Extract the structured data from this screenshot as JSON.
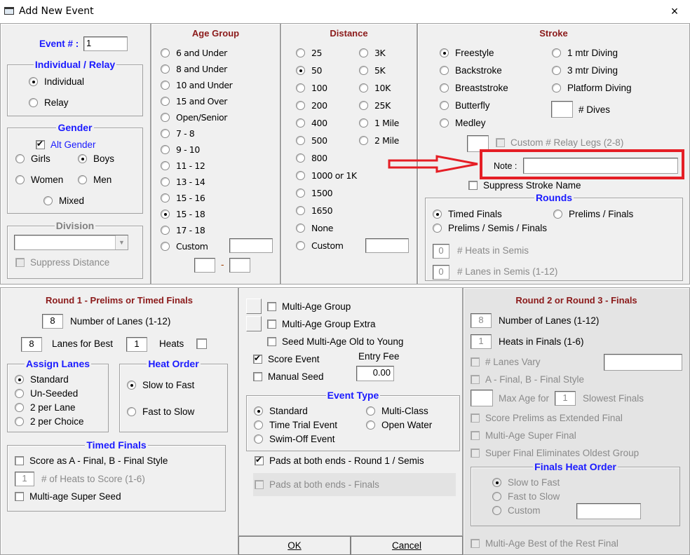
{
  "window": {
    "title": "Add New Event",
    "close_label": "×"
  },
  "event": {
    "number_label": "Event # :",
    "number_value": "1"
  },
  "individual_relay": {
    "title": "Individual / Relay",
    "options": [
      "Individual",
      "Relay"
    ],
    "selected": "Individual"
  },
  "gender": {
    "title": "Gender",
    "alt_gender_label": "Alt Gender",
    "alt_gender_checked": true,
    "options": [
      "Girls",
      "Boys",
      "Women",
      "Men",
      "Mixed"
    ],
    "selected": "Boys"
  },
  "division": {
    "title": "Division",
    "value": "",
    "suppress_distance_label": "Suppress Distance"
  },
  "age_group": {
    "title": "Age Group",
    "options": [
      "6 and Under",
      "8 and Under",
      "10 and Under",
      "15 and Over",
      "Open/Senior",
      "7 - 8",
      "9 - 10",
      "11 - 12",
      "13 - 14",
      "15 - 16",
      "15 - 18",
      "17 - 18",
      "Custom"
    ],
    "selected": "15 - 18",
    "range_separator": "-"
  },
  "distance": {
    "title": "Distance",
    "col1": [
      "25",
      "50",
      "100",
      "200",
      "400",
      "500",
      "800",
      "1000 or 1K",
      "1500",
      "1650",
      "None",
      "Custom"
    ],
    "col2": [
      "3K",
      "5K",
      "10K",
      "25K",
      "1 Mile",
      "2 Mile"
    ],
    "selected": "50"
  },
  "stroke": {
    "title": "Stroke",
    "col1": [
      "Freestyle",
      "Backstroke",
      "Breaststroke",
      "Butterfly",
      "Medley"
    ],
    "col2": [
      "1 mtr Diving",
      "3 mtr Diving",
      "Platform Diving"
    ],
    "selected": "Freestyle",
    "dives_label": "# Dives",
    "relay_legs_label": "Custom # Relay Legs (2-8)",
    "note_label": "Note :",
    "note_value": "",
    "suppress_stroke_label": "Suppress Stroke Name"
  },
  "rounds": {
    "title": "Rounds",
    "options": [
      "Timed Finals",
      "Prelims / Finals",
      "Prelims / Semis / Finals"
    ],
    "selected": "Timed Finals",
    "heats_semis_value": "0",
    "heats_semis_label": "# Heats in Semis",
    "lanes_semis_value": "0",
    "lanes_semis_label": "# Lanes in Semis (1-12)"
  },
  "round1": {
    "title": "Round 1 - Prelims or Timed Finals",
    "num_lanes_value": "8",
    "num_lanes_label": "Number of Lanes (1-12)",
    "lanes_best_value": "8",
    "lanes_best_label": "Lanes for Best",
    "heats_value": "1",
    "heats_label": "Heats",
    "assign_lanes": {
      "title": "Assign Lanes",
      "options": [
        "Standard",
        "Un-Seeded",
        "2 per Lane",
        "2 per Choice"
      ],
      "selected": "Standard"
    },
    "heat_order": {
      "title": "Heat Order",
      "options": [
        "Slow to Fast",
        "Fast to Slow"
      ],
      "selected": "Slow to Fast"
    },
    "timed_finals": {
      "title": "Timed Finals",
      "score_ab_label": "Score as A - Final, B - Final Style",
      "heats_score_value": "1",
      "heats_score_label": "# of Heats to Score (1-6)",
      "super_seed_label": "Multi-age Super Seed"
    }
  },
  "middle": {
    "multi_age_group_label": "Multi-Age Group",
    "multi_age_extra_label": "Multi-Age Group Extra",
    "seed_old_young_label": "Seed Multi-Age Old to Young",
    "score_event_label": "Score Event",
    "score_event_checked": true,
    "manual_seed_label": "Manual Seed",
    "entry_fee_label": "Entry Fee",
    "entry_fee_value": "0.00",
    "event_type": {
      "title": "Event Type",
      "options": [
        "Standard",
        "Multi-Class",
        "Time Trial Event",
        "Open Water",
        "Swim-Off Event"
      ],
      "selected": "Standard"
    },
    "pads_round1_label": "Pads at both ends - Round 1 / Semis",
    "pads_round1_checked": true,
    "pads_finals_label": "Pads at both ends - Finals"
  },
  "buttons": {
    "ok": "OK",
    "cancel": "Cancel"
  },
  "round2": {
    "title": "Round 2 or Round 3 - Finals",
    "num_lanes_value": "8",
    "num_lanes_label": "Number of Lanes (1-12)",
    "heats_finals_value": "1",
    "heats_finals_label": "Heats in Finals (1-6)",
    "lanes_vary_label": "# Lanes Vary",
    "ab_style_label": "A - Final, B - Final Style",
    "max_age_label": "Max Age for",
    "slowest_value": "1",
    "slowest_label": "Slowest Finals",
    "score_prelims_label": "Score Prelims as Extended Final",
    "super_final_label": "Multi-Age Super Final",
    "super_final_elim_label": "Super Final Eliminates Oldest Group",
    "finals_heat_order": {
      "title": "Finals Heat Order",
      "options": [
        "Slow to Fast",
        "Fast to Slow",
        "Custom"
      ],
      "selected": "Slow to Fast"
    },
    "best_rest_label": "Multi-Age Best of the Rest Final"
  },
  "colors": {
    "panel_title": "#8b1a1a",
    "group_title": "#1a1aff",
    "highlight": "#e51e25"
  }
}
